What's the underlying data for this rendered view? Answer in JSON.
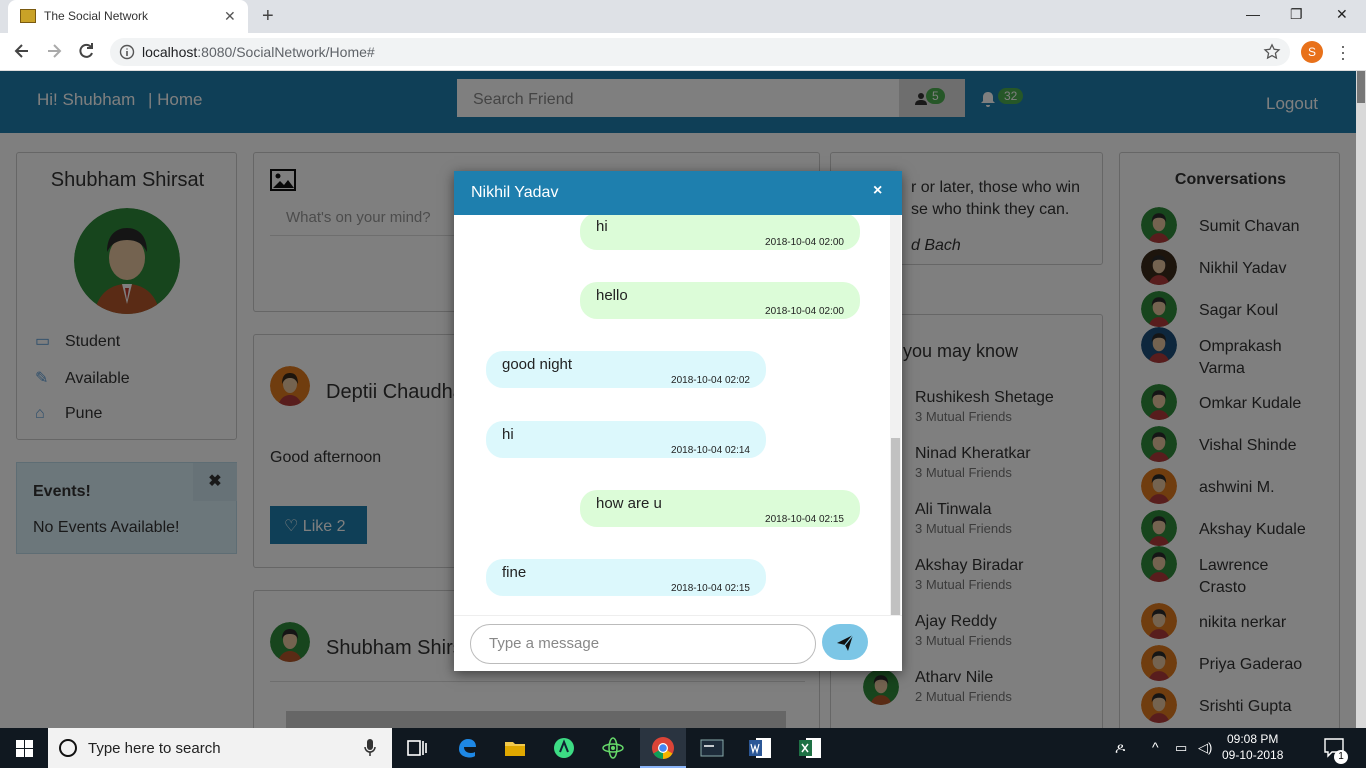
{
  "browser": {
    "tab_title": "The Social Network",
    "tab_close": "✕",
    "new_tab": "+",
    "url_host": "localhost",
    "url_path": ":8080/SocialNetwork/Home#",
    "profile_initial": "S",
    "window_min": "—",
    "window_max": "❐",
    "window_close": "✕"
  },
  "nav": {
    "greeting": "Hi! Shubham",
    "home": "| Home",
    "search_placeholder": "Search Friend",
    "friend_requests": "5",
    "notifications": "32",
    "logout": "Logout"
  },
  "profile": {
    "name": "Shubham Shirsat",
    "info": [
      "Student",
      "Available",
      "Pune"
    ]
  },
  "events": {
    "title": "Events!",
    "close": "✖",
    "text": "No Events Available!"
  },
  "post_box": {
    "placeholder": "What's on your mind?"
  },
  "posts": [
    {
      "author": "Deptii Chaudha",
      "text": "Good afternoon",
      "like_label": "Like 2"
    },
    {
      "author": "Shubham Shirs"
    }
  ],
  "quote": {
    "text": "r or later, those who win se who think they can.",
    "author": "d Bach"
  },
  "people_you_may_know": {
    "title": "you may know",
    "people": [
      {
        "name": "Rushikesh Shetage",
        "mutual": "3 Mutual Friends"
      },
      {
        "name": "Ninad Kheratkar",
        "mutual": "3 Mutual Friends"
      },
      {
        "name": "Ali Tinwala",
        "mutual": "3 Mutual Friends"
      },
      {
        "name": "Akshay Biradar",
        "mutual": "3 Mutual Friends"
      },
      {
        "name": "Ajay Reddy",
        "mutual": "3 Mutual Friends"
      },
      {
        "name": "Atharv Nile",
        "mutual": "2 Mutual Friends"
      }
    ]
  },
  "conversations": {
    "title": "Conversations",
    "items": [
      "Sumit Chavan",
      "Nikhil Yadav",
      "Sagar Koul",
      "Omprakash Varma",
      "Omkar Kudale",
      "Vishal Shinde",
      "ashwini M.",
      "Akshay Kudale",
      "Lawrence Crasto",
      "nikita nerkar",
      "Priya Gaderao",
      "Srishti Gupta"
    ]
  },
  "chat": {
    "title": "Nikhil Yadav",
    "close": "×",
    "messages": [
      {
        "text": "hi",
        "time": "2018-10-04 02:00",
        "dir": "out"
      },
      {
        "text": "hello",
        "time": "2018-10-04 02:00",
        "dir": "out"
      },
      {
        "text": "good night",
        "time": "2018-10-04 02:02",
        "dir": "in"
      },
      {
        "text": "hi",
        "time": "2018-10-04 02:14",
        "dir": "in"
      },
      {
        "text": "how are u",
        "time": "2018-10-04 02:15",
        "dir": "out"
      },
      {
        "text": "fine",
        "time": "2018-10-04 02:15",
        "dir": "in"
      }
    ],
    "input_placeholder": "Type a message"
  },
  "taskbar": {
    "search_placeholder": "Type here to search",
    "time": "09:08 PM",
    "date": "09-10-2018",
    "notification_count": "1"
  },
  "colors": {
    "brand": "#1e7fae",
    "badge": "#4caf50",
    "outgoing_bubble": "#dcfcd8",
    "incoming_bubble": "#dcf8fc"
  }
}
